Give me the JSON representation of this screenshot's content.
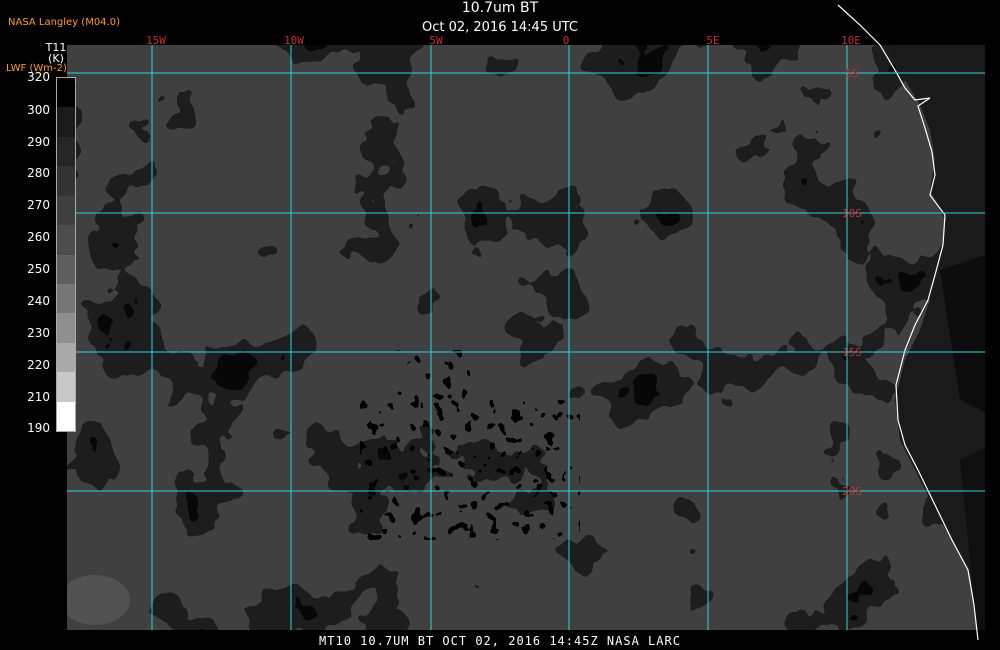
{
  "header": {
    "source": "NASA Langley (M04.0)",
    "title": "10.7um BT",
    "datetime": "Oct 02, 2016 14:45 UTC"
  },
  "legend": {
    "variable": "T11",
    "unit": "(K)",
    "alt_variable": "LWF (Wm-2)",
    "ticks": [
      "320",
      "300",
      "290",
      "280",
      "270",
      "260",
      "250",
      "240",
      "230",
      "220",
      "210",
      "190"
    ]
  },
  "grid": {
    "longitude_labels": [
      "15W",
      "10W",
      "5W",
      "0",
      "5E",
      "10E"
    ],
    "latitude_labels": [
      "5S",
      "10S",
      "15S",
      "20S"
    ],
    "grid_color": "#2fd3e0",
    "label_color": "#c03030"
  },
  "footer": {
    "text": "MT10  10.7UM BT   OCT 02, 2016 14:45Z   NASA LARC"
  }
}
